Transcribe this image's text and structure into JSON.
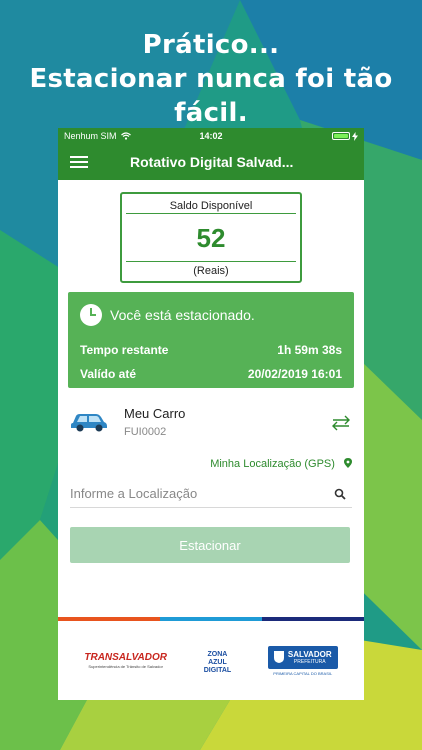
{
  "headline": {
    "line1": "Prático...",
    "line2": "Estacionar nunca foi tão fácil."
  },
  "status_bar": {
    "carrier": "Nenhum SIM",
    "time": "14:02"
  },
  "app_bar": {
    "title": "Rotativo Digital Salvad..."
  },
  "saldo": {
    "title": "Saldo Disponível",
    "value": "52",
    "unit": "(Reais)"
  },
  "parked": {
    "message": "Você está estacionado.",
    "remaining_label": "Tempo restante",
    "remaining_value": "1h 59m 38s",
    "valid_label": "Valído até",
    "valid_value": "20/02/2019 16:01"
  },
  "vehicle": {
    "name": "Meu Carro",
    "plate": "FUI0002"
  },
  "location": {
    "gps_label": "Minha Localização (GPS)",
    "placeholder": "Informe a Localização"
  },
  "actions": {
    "park_label": "Estacionar"
  },
  "footer": {
    "logo1": "TRANSALVADOR",
    "logo1_sub": "Superintendência de Trânsito de Salvador",
    "logo2_lines": [
      "ZONA",
      "AZUL",
      "DIGITAL"
    ],
    "logo3": "SALVADOR",
    "logo3_sub": "PREFEITURA",
    "logo3_caption": "PRIMEIRA CAPITAL DO BRASIL"
  },
  "colors": {
    "primary": "#2e8b2e",
    "card": "#56b256",
    "button_disabled": "#a8d4b2",
    "stripe": [
      "#e8541e",
      "#1f9bd6",
      "#1b2a7a"
    ]
  }
}
